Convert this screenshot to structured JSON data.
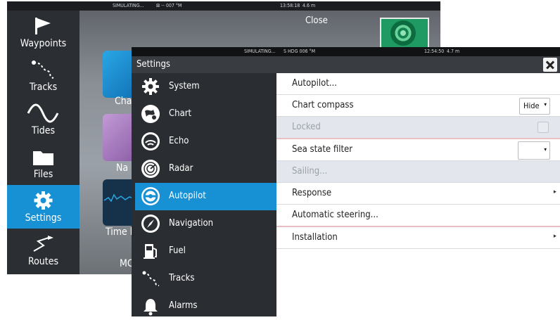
{
  "home": {
    "status": {
      "sim": "SIMULATING...",
      "hdg": "⊠ -- 007 °M",
      "time": "13:58:18",
      "depth": "4.6 m"
    },
    "sidebar": [
      {
        "label": "Waypoints",
        "icon": "flag-icon"
      },
      {
        "label": "Tracks",
        "icon": "track-icon"
      },
      {
        "label": "Tides",
        "icon": "wave-icon"
      },
      {
        "label": "Files",
        "icon": "folder-icon"
      },
      {
        "label": "Settings",
        "icon": "gear-icon",
        "active": true
      },
      {
        "label": "Routes",
        "icon": "route-icon"
      }
    ],
    "tiles": {
      "chart": "Cha",
      "nav": "Na",
      "time": "Time l",
      "mo": "MC"
    },
    "close_label": "Close"
  },
  "dialog": {
    "status": {
      "sim": "SIMULATING...",
      "hdg": "S HDG 006 °M",
      "time": "12:54:50",
      "depth": "4.7 m"
    },
    "title": "Settings",
    "sidebar": [
      {
        "label": "System",
        "icon": "gear-icon"
      },
      {
        "label": "Chart",
        "icon": "chart-icon"
      },
      {
        "label": "Echo",
        "icon": "echo-icon"
      },
      {
        "label": "Radar",
        "icon": "radar-icon"
      },
      {
        "label": "Autopilot",
        "icon": "autopilot-icon",
        "active": true
      },
      {
        "label": "Navigation",
        "icon": "compass-icon"
      },
      {
        "label": "Fuel",
        "icon": "fuel-icon"
      },
      {
        "label": "Tracks",
        "icon": "track-icon"
      },
      {
        "label": "Alarms",
        "icon": "bell-icon"
      }
    ],
    "rows": [
      {
        "label": "Autopilot...",
        "type": "link"
      },
      {
        "label": "Chart compass",
        "type": "dropdown",
        "value": "Hide"
      },
      {
        "label": "Locked",
        "type": "checkbox",
        "disabled": true,
        "checked": false
      },
      {
        "label": "Sea state filter",
        "type": "dropdown",
        "value": ""
      },
      {
        "label": "Sailing...",
        "type": "link",
        "disabled": true
      },
      {
        "label": "Response",
        "type": "submenu"
      },
      {
        "label": "Automatic steering...",
        "type": "link"
      },
      {
        "label": "Installation",
        "type": "submenu"
      }
    ]
  },
  "colors": {
    "accent": "#1790d4",
    "panel": "#2a2d31",
    "disabled_row": "#e3e7ed",
    "separator": "#e9bfc4"
  }
}
